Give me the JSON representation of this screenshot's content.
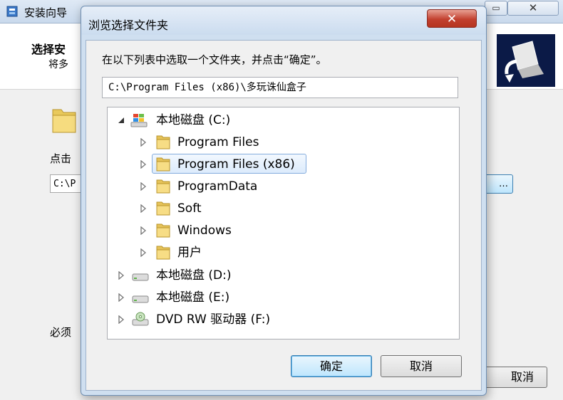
{
  "background_window": {
    "title": "安装向导",
    "heading": "选择安",
    "subheading": "将多",
    "click_label": "点击",
    "path_value": "C:\\P",
    "browse_label": "…",
    "required_label": "必须",
    "cancel_label": "取消",
    "restore_glyph": "▭",
    "close_glyph": "✕"
  },
  "dialog": {
    "title": "浏览选择文件夹",
    "close_glyph": "✕",
    "instruction": "在以下列表中选取一个文件夹，并点击“确定”。",
    "path_value": "C:\\Program Files (x86)\\多玩诛仙盒子",
    "ok_label": "确定",
    "cancel_label": "取消"
  },
  "tree": {
    "items": [
      {
        "label": "本地磁盘 (C:)",
        "icon": "windows-drive-icon",
        "expanded": true
      },
      {
        "label": "Program Files",
        "icon": "folder-icon"
      },
      {
        "label": "Program Files (x86)",
        "icon": "folder-icon",
        "selected": true
      },
      {
        "label": "ProgramData",
        "icon": "folder-icon"
      },
      {
        "label": "Soft",
        "icon": "folder-icon"
      },
      {
        "label": "Windows",
        "icon": "folder-icon"
      },
      {
        "label": "用户",
        "icon": "folder-icon"
      },
      {
        "label": "本地磁盘 (D:)",
        "icon": "drive-icon"
      },
      {
        "label": "本地磁盘 (E:)",
        "icon": "drive-icon"
      },
      {
        "label": "DVD RW 驱动器 (F:)",
        "icon": "dvd-drive-icon"
      }
    ]
  },
  "colors": {
    "selection_border": "#84acdd",
    "close_button": "#c2402f",
    "logo_background": "#0b1a47"
  }
}
